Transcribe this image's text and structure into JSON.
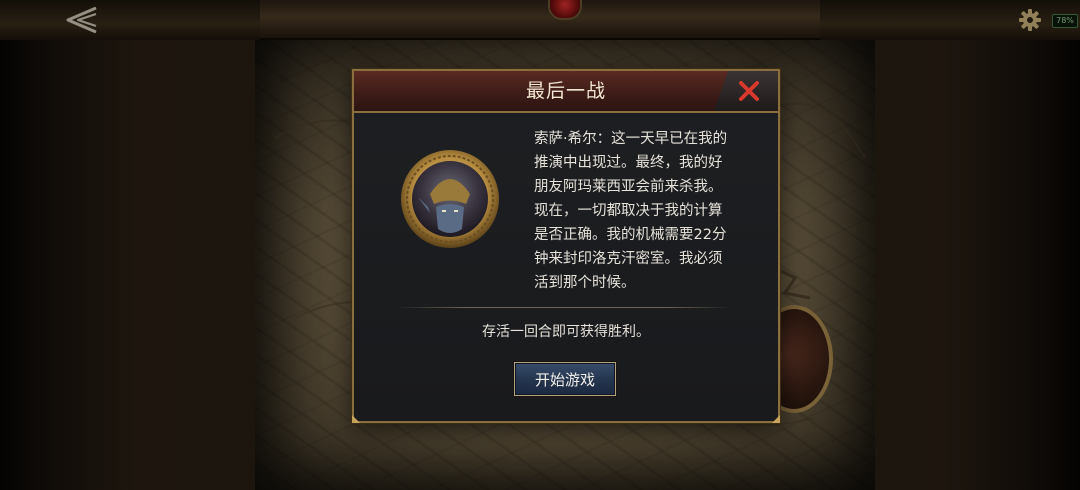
{
  "dialog": {
    "title": "最后一战",
    "close_label": "X",
    "speaker_text": "索萨·希尔：这一天早已在我的\n推演中出现过。最终，我的好\n朋友阿玛莱西亚会前来杀我。\n现在，一切都取决于我的计算\n是否正确。我的机械需要22分\n钟来封印洛克汗密室。我必须\n活到那个时候。",
    "objective": "存活一回合即可获得胜利。",
    "start_button": "开始游戏"
  },
  "status_bar": {
    "battery": "78%"
  },
  "icons": {
    "back": "back-arrow-icon",
    "settings": "gear-icon",
    "close": "close-icon"
  },
  "colors": {
    "close_x": "#d8392c",
    "frame_gold": "#8a6e3d",
    "header_red": "#5a2a22",
    "button_blue": "#253650"
  }
}
